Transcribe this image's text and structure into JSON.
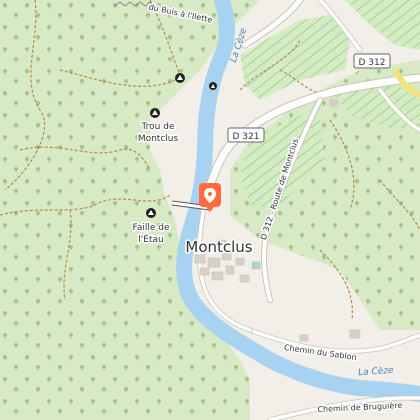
{
  "map": {
    "places": {
      "village": "Montclus",
      "cave1_line1": "Trou de",
      "cave1_line2": "Montclus",
      "cave2_line1": "Faille de",
      "cave2_line2": "l'Étau"
    },
    "roads": {
      "d321": "D 321",
      "d312": "D 312",
      "route_montclus": "D 312 - Route de Montclus",
      "chemin_sablon": "Chemin du Sablon",
      "chemin_bruguiere": "Chemin de Bruguière",
      "trail_top": "du Buis à l'Ilette"
    },
    "water": {
      "river_upper": "La Cèze",
      "river_lower": "La Cèze"
    },
    "marker": {
      "icon": "location-pin-icon",
      "color": "#ff6b3d"
    },
    "colors": {
      "forest": "#d8e9c6",
      "cleared": "#f2efe9",
      "river": "#a8d3f0",
      "vineyard": "#cfe8bd",
      "road": "#ffffff",
      "track": "#b58a4a"
    }
  }
}
